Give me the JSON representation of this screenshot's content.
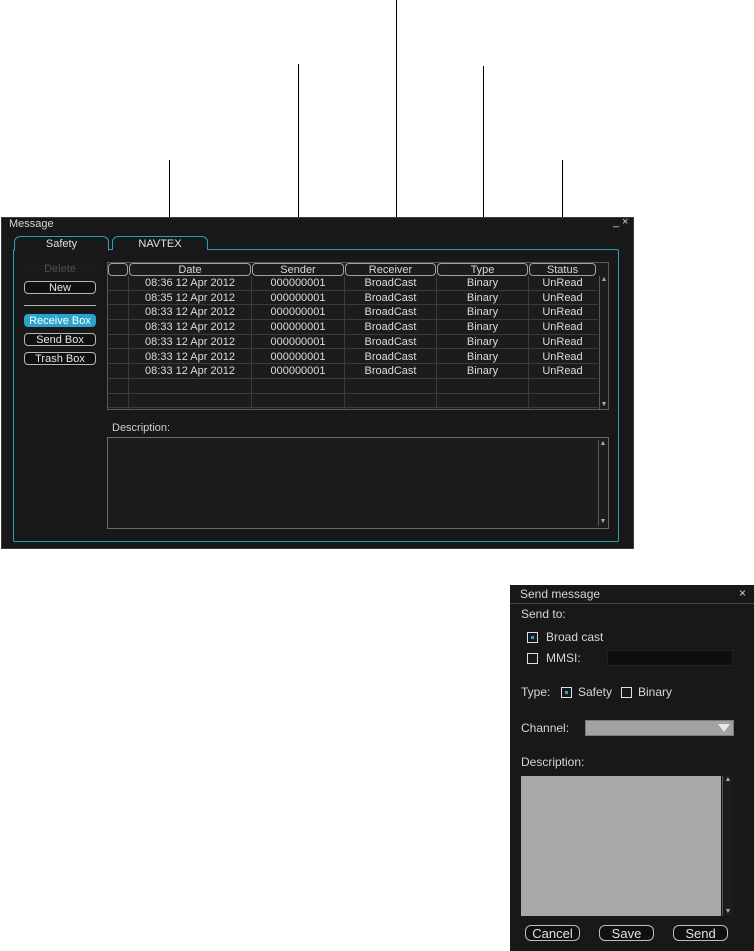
{
  "message_window": {
    "title": "Message",
    "controls": {
      "minimize": "_",
      "close": "×"
    },
    "tabs": [
      {
        "label": "Safety",
        "active": true
      },
      {
        "label": "NAVTEX",
        "active": false
      }
    ],
    "side_buttons": {
      "delete": "Delete",
      "new": "New",
      "receive_box": "Receive Box",
      "send_box": "Send Box",
      "trash_box": "Trash Box"
    },
    "columns": [
      "Date",
      "Sender",
      "Receiver",
      "Type",
      "Status"
    ],
    "rows": [
      {
        "date": "08:36  12 Apr 2012",
        "sender": "000000001",
        "receiver": "BroadCast",
        "type": "Binary",
        "status": "UnRead"
      },
      {
        "date": "08:35  12 Apr 2012",
        "sender": "000000001",
        "receiver": "BroadCast",
        "type": "Binary",
        "status": "UnRead"
      },
      {
        "date": "08:33  12 Apr 2012",
        "sender": "000000001",
        "receiver": "BroadCast",
        "type": "Binary",
        "status": "UnRead"
      },
      {
        "date": "08:33  12 Apr 2012",
        "sender": "000000001",
        "receiver": "BroadCast",
        "type": "Binary",
        "status": "UnRead"
      },
      {
        "date": "08:33  12 Apr 2012",
        "sender": "000000001",
        "receiver": "BroadCast",
        "type": "Binary",
        "status": "UnRead"
      },
      {
        "date": "08:33  12 Apr 2012",
        "sender": "000000001",
        "receiver": "BroadCast",
        "type": "Binary",
        "status": "UnRead"
      },
      {
        "date": "08:33  12 Apr 2012",
        "sender": "000000001",
        "receiver": "BroadCast",
        "type": "Binary",
        "status": "UnRead"
      }
    ],
    "empty_row_count": 2,
    "description_label": "Description:"
  },
  "send_dialog": {
    "title": "Send message",
    "close": "×",
    "send_to_label": "Send to:",
    "options": {
      "broadcast": "Broad cast",
      "mmsi": "MMSI:"
    },
    "broadcast_checked": true,
    "mmsi_checked": false,
    "type_label": "Type:",
    "type_options": {
      "safety": "Safety",
      "binary": "Binary"
    },
    "safety_checked": true,
    "binary_checked": false,
    "channel_label": "Channel:",
    "description_label": "Description:",
    "buttons": {
      "cancel": "Cancel",
      "save": "Save",
      "send": "Send"
    }
  },
  "colors": {
    "window_bg": "#181818",
    "accent": "#2aa3cc",
    "text": "#dcdcdc",
    "field_gray": "#a8a8a8"
  }
}
